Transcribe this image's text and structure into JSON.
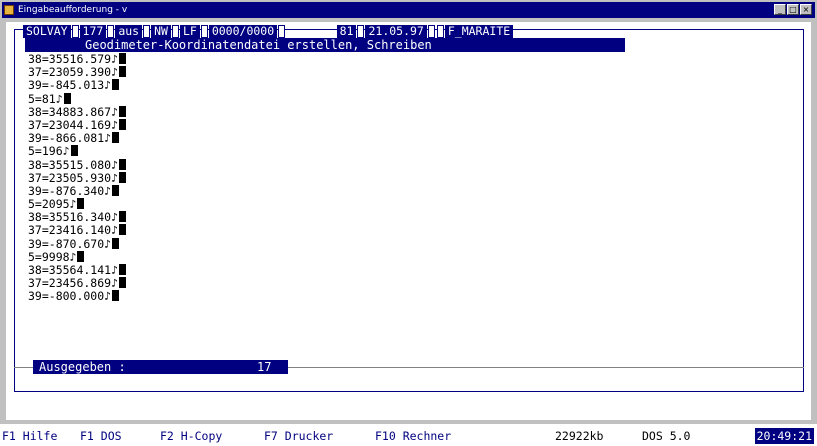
{
  "window": {
    "title": "Eingabeaufforderung - v",
    "buttons": [
      "_",
      "□",
      "×"
    ]
  },
  "header": {
    "segments": [
      "SOLVAY",
      "177",
      "aus",
      "NW",
      "LF",
      "0000/0000",
      "81",
      "21.05.97",
      "F_MARAITE"
    ],
    "subtitle": "Geodimeter-Koordinatendatei erstellen, Schreiben"
  },
  "lines": [
    "38=35516.579♪",
    "37=23059.390♪",
    "39=-845.013♪",
    "5=81♪",
    "38=34883.867♪",
    "37=23044.169♪",
    "39=-866.081♪",
    "5=196♪",
    "38=35515.080♪",
    "37=23505.930♪",
    "39=-876.340♪",
    "5=2095♪",
    "38=35516.340♪",
    "37=23416.140♪",
    "39=-870.670♪",
    "5=9998♪",
    "38=35564.141♪",
    "37=23456.869♪",
    "39=-800.000♪"
  ],
  "footer_status": {
    "label": "Ausgegeben :",
    "value": "17"
  },
  "fkeys": {
    "f1": "F1 Hilfe",
    "f1_dos": "F1 DOS",
    "f2": "F2 H-Copy",
    "f7": "F7 Drucker",
    "f10": "F10 Rechner",
    "memory": "22922kb",
    "dos": "DOS 5.0",
    "clock": "20:49:21"
  },
  "colors": {
    "console_bg": "#ffffff",
    "highlight": "#000080"
  }
}
